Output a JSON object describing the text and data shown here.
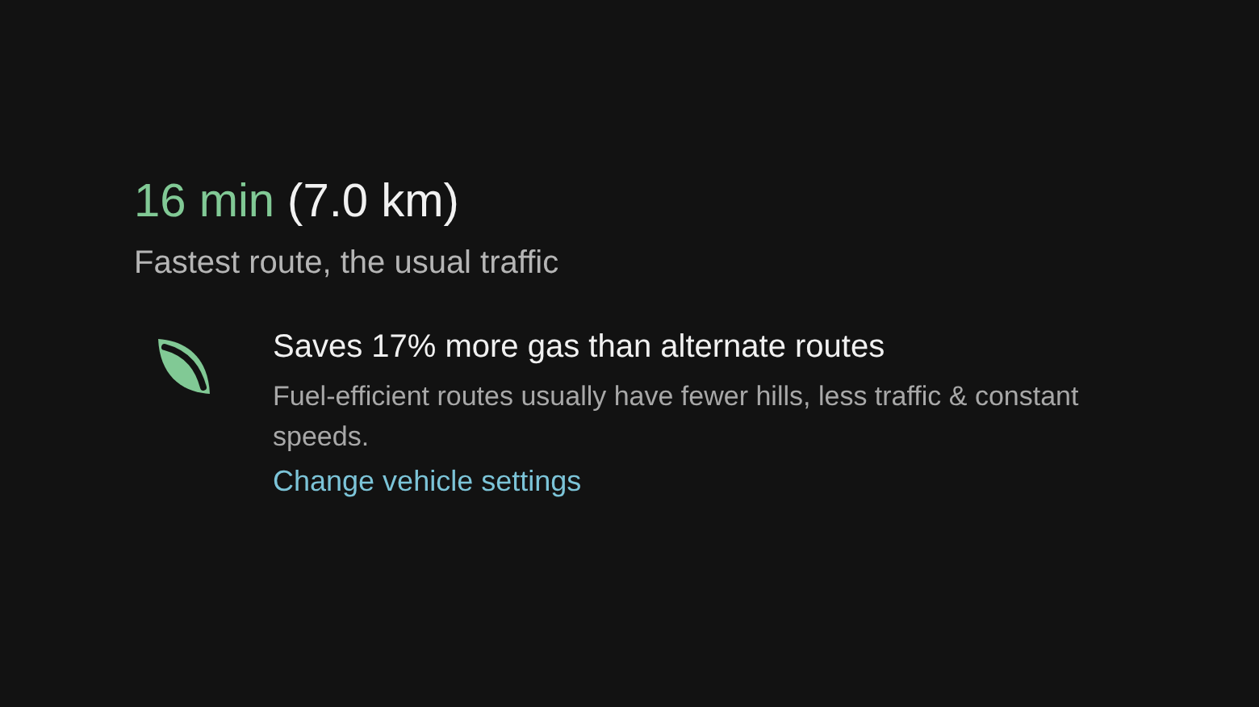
{
  "route": {
    "duration": "16 min",
    "distance": "(7.0 km)",
    "summary": "Fastest route, the usual traffic"
  },
  "eco": {
    "heading": "Saves 17% more gas than alternate routes",
    "description": "Fuel-efficient routes usually have fewer hills, less traffic & constant speeds.",
    "link": "Change vehicle settings"
  }
}
